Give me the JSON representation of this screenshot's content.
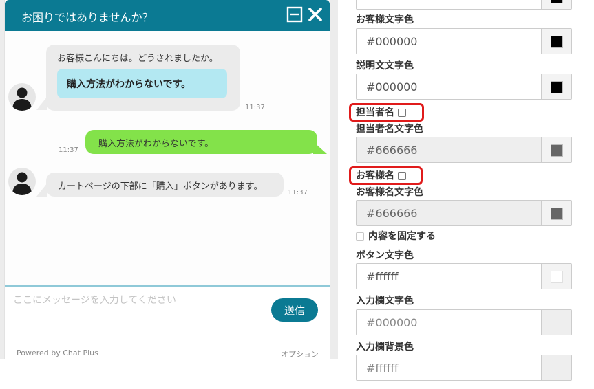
{
  "chat": {
    "title": "お困りではありませんか？",
    "header_color": "#0b7a93",
    "messages": [
      {
        "from": "operator",
        "text": "お客様こんにちは。どうされましたか。",
        "time": "11:37",
        "quick_reply": "購入方法がわからないです。"
      },
      {
        "from": "customer",
        "text": "購入方法がわからないです。",
        "time": "11:37"
      },
      {
        "from": "operator",
        "text": "カートページの下部に「購入」ボタンがあります。",
        "time": "11:37"
      }
    ],
    "input_placeholder": "ここにメッセージを入力してください",
    "send_label": "送信",
    "powered_by": "Powered by Chat Plus",
    "options_label": "オプション"
  },
  "settings": {
    "customer_text_color": {
      "label": "お客様文字色",
      "value": "#000000",
      "swatch": "#000000"
    },
    "description_text_color": {
      "label": "説明文文字色",
      "value": "#000000",
      "swatch": "#000000"
    },
    "agent_name_toggle": {
      "label": "担当者名",
      "checked": false
    },
    "agent_name_color": {
      "label": "担当者名文字色",
      "value": "#666666",
      "swatch": "#666666"
    },
    "customer_name_toggle": {
      "label": "お客様名",
      "checked": false
    },
    "customer_name_color": {
      "label": "お客様名文字色",
      "value": "#666666",
      "swatch": "#666666"
    },
    "fix_content": {
      "label": "内容を固定する",
      "checked": false
    },
    "button_text_color": {
      "label": "ボタン文字色",
      "value": "#ffffff",
      "swatch": "#ffffff"
    },
    "input_text_color": {
      "label": "入力欄文字色",
      "value": "#000000"
    },
    "input_bg_color": {
      "label": "入力欄背景色",
      "value": "#ffffff"
    },
    "highlight_color": "#e01b1b"
  }
}
